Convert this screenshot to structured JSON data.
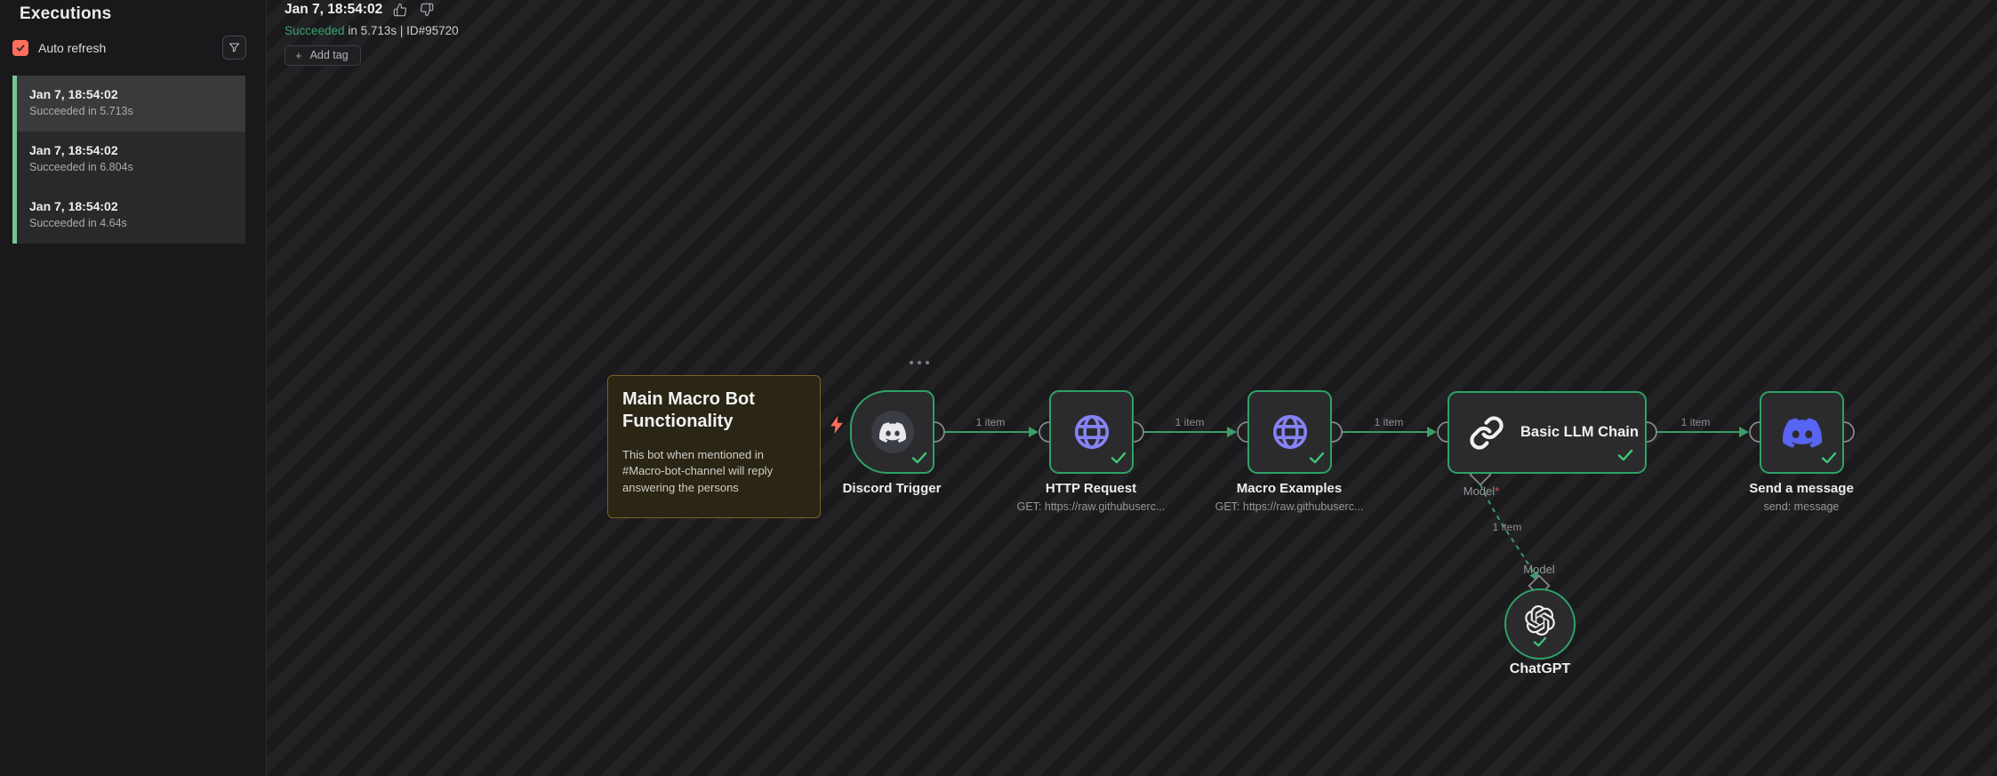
{
  "colors": {
    "success_green": "#2ea266",
    "connection_green": "#3a9d68",
    "accent_red": "#ff6d5c",
    "sticky_bg": "#2a2514",
    "discord_blurple": "#5865f2",
    "node_icon_purple": "#8583f4"
  },
  "sidebar": {
    "title": "Executions",
    "auto_refresh_label": "Auto refresh",
    "auto_refresh_checked": true,
    "executions": [
      {
        "date": "Jan 7, 18:54:02",
        "status": "Succeeded in 5.713s",
        "selected": true
      },
      {
        "date": "Jan 7, 18:54:02",
        "status": "Succeeded in 6.804s",
        "selected": false
      },
      {
        "date": "Jan 7, 18:54:02",
        "status": "Succeeded in 4.64s",
        "selected": false
      }
    ]
  },
  "header": {
    "title": "Jan 7, 18:54:02",
    "status": "Succeeded",
    "status_detail": " in 5.713s | ID#95720",
    "add_tag_plus": "+",
    "add_tag_label": "Add tag"
  },
  "canvas": {
    "sticky": {
      "title": "Main Macro Bot Functionality",
      "body": "This bot when mentioned in #Macro-bot-channel will reply answering the persons"
    },
    "item_label": "1 item",
    "model_required": {
      "label": "Model",
      "asterisk": "*"
    },
    "model_label": "Model",
    "nodes": {
      "trigger": {
        "name": "Discord Trigger"
      },
      "http": {
        "name": "HTTP Request",
        "subtitle": "GET: https://raw.githubuserc..."
      },
      "macro": {
        "name": "Macro Examples",
        "subtitle": "GET: https://raw.githubuserc..."
      },
      "llm": {
        "name": "Basic LLM Chain"
      },
      "send": {
        "name": "Send a message",
        "subtitle": "send: message"
      },
      "chatgpt": {
        "name": "ChatGPT"
      }
    }
  }
}
